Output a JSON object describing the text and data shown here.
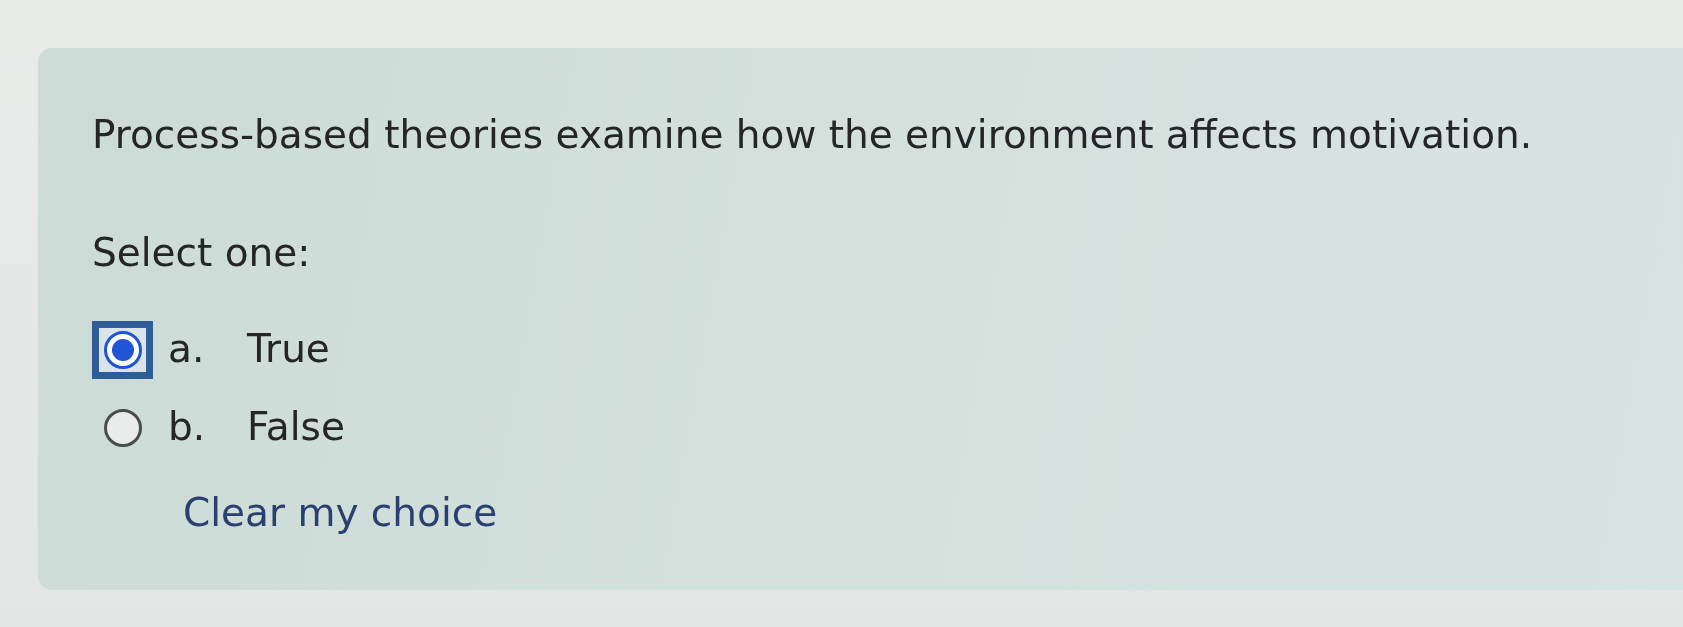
{
  "question": {
    "text": "Process-based theories examine how the environment affects motivation.",
    "prompt": "Select one:"
  },
  "options": [
    {
      "letter": "a.",
      "label": "True",
      "selected": true,
      "focused": true
    },
    {
      "letter": "b.",
      "label": "False",
      "selected": false,
      "focused": false
    }
  ],
  "clear_link": "Clear my choice"
}
